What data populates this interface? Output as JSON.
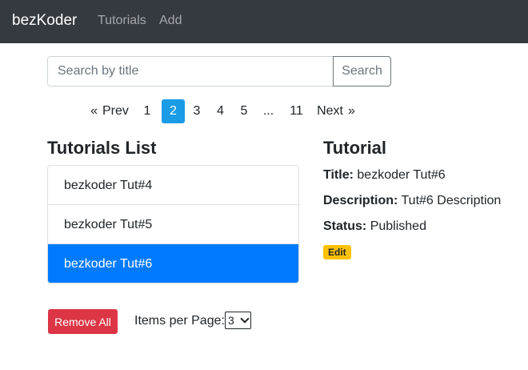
{
  "navbar": {
    "brand": "bezKoder",
    "links": [
      "Tutorials",
      "Add"
    ]
  },
  "search": {
    "placeholder": "Search by title",
    "value": "",
    "button_label": "Search"
  },
  "pagination": {
    "prev_arrow": "«",
    "prev_label": "Prev",
    "pages": [
      "1",
      "2",
      "3",
      "4",
      "5",
      "...",
      "11"
    ],
    "active_page": "2",
    "next_label": "Next",
    "next_arrow": "»"
  },
  "list": {
    "title": "Tutorials List",
    "items": [
      "bezkoder Tut#4",
      "bezkoder Tut#5",
      "bezkoder Tut#6"
    ],
    "selected": "bezkoder Tut#6"
  },
  "detail": {
    "title": "Tutorial",
    "title_label": "Title:",
    "title_value": "bezkoder Tut#6",
    "description_label": "Description:",
    "description_value": "Tut#6 Description",
    "status_label": "Status:",
    "status_value": "Published",
    "edit_label": "Edit"
  },
  "footer": {
    "remove_all_label": "Remove All",
    "items_per_page_label": "Items per Page:",
    "items_per_page_value": "3"
  },
  "colors": {
    "navbar": "#343a40",
    "active_page": "#1a9be6",
    "active_item": "#007bff",
    "danger": "#dc3545",
    "warning": "#ffc107"
  },
  "icons": [
    "chevron-down-icon"
  ]
}
